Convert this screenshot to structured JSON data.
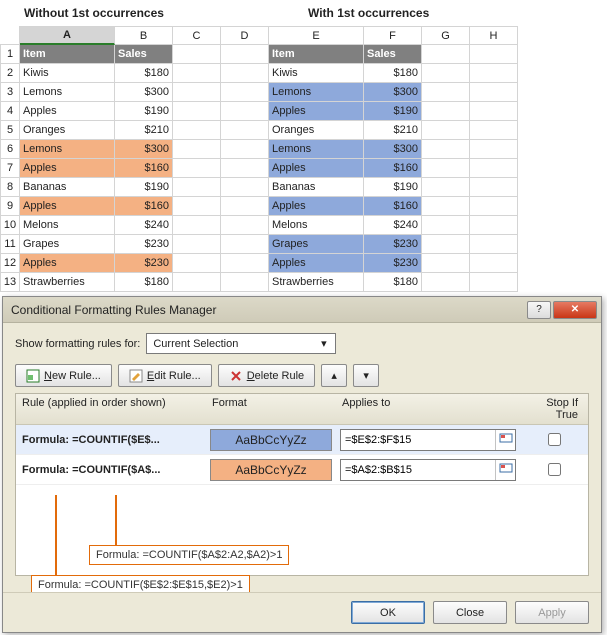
{
  "titles": {
    "left": "Without 1st occurrences",
    "right": "With 1st occurrences"
  },
  "columns": [
    "A",
    "B",
    "C",
    "D",
    "E",
    "F",
    "G",
    "H"
  ],
  "rows": [
    1,
    2,
    3,
    4,
    5,
    6,
    7,
    8,
    9,
    10,
    11,
    12,
    13
  ],
  "header_left": {
    "item": "Item",
    "sales": "Sales"
  },
  "header_right": {
    "item": "Item",
    "sales": "Sales"
  },
  "data_left": [
    {
      "item": "Kiwis",
      "sales": "$180",
      "hl": false
    },
    {
      "item": "Lemons",
      "sales": "$300",
      "hl": false
    },
    {
      "item": "Apples",
      "sales": "$190",
      "hl": false
    },
    {
      "item": "Oranges",
      "sales": "$210",
      "hl": false
    },
    {
      "item": "Lemons",
      "sales": "$300",
      "hl": true
    },
    {
      "item": "Apples",
      "sales": "$160",
      "hl": true
    },
    {
      "item": "Bananas",
      "sales": "$190",
      "hl": false
    },
    {
      "item": "Apples",
      "sales": "$160",
      "hl": true
    },
    {
      "item": "Melons",
      "sales": "$240",
      "hl": false
    },
    {
      "item": "Grapes",
      "sales": "$230",
      "hl": false
    },
    {
      "item": "Apples",
      "sales": "$230",
      "hl": true
    },
    {
      "item": "Strawberries",
      "sales": "$180",
      "hl": false
    }
  ],
  "data_right": [
    {
      "item": "Kiwis",
      "sales": "$180",
      "hl": false
    },
    {
      "item": "Lemons",
      "sales": "$300",
      "hl": true
    },
    {
      "item": "Apples",
      "sales": "$190",
      "hl": true
    },
    {
      "item": "Oranges",
      "sales": "$210",
      "hl": false
    },
    {
      "item": "Lemons",
      "sales": "$300",
      "hl": true
    },
    {
      "item": "Apples",
      "sales": "$160",
      "hl": true
    },
    {
      "item": "Bananas",
      "sales": "$190",
      "hl": false
    },
    {
      "item": "Apples",
      "sales": "$160",
      "hl": true
    },
    {
      "item": "Melons",
      "sales": "$240",
      "hl": false
    },
    {
      "item": "Grapes",
      "sales": "$230",
      "hl": true
    },
    {
      "item": "Apples",
      "sales": "$230",
      "hl": true
    },
    {
      "item": "Strawberries",
      "sales": "$180",
      "hl": false
    }
  ],
  "dialog": {
    "title": "Conditional Formatting Rules Manager",
    "show_label": "Show formatting rules for:",
    "show_value": "Current Selection",
    "buttons": {
      "new": "New Rule...",
      "edit": "Edit Rule...",
      "delete": "Delete Rule"
    },
    "cols": {
      "rule": "Rule (applied in order shown)",
      "format": "Format",
      "applies": "Applies to",
      "stop": "Stop If True"
    },
    "rules": [
      {
        "name": "Formula: =COUNTIF($E$...",
        "sample": "AaBbCcYyZz",
        "applies": "=$E$2:$F$15",
        "class": "blue"
      },
      {
        "name": "Formula: =COUNTIF($A$...",
        "sample": "AaBbCcYyZz",
        "applies": "=$A$2:$B$15",
        "class": "orange"
      }
    ],
    "footer": {
      "ok": "OK",
      "close": "Close",
      "apply": "Apply"
    }
  },
  "callouts": {
    "inner": "Formula: =COUNTIF($A$2:A2,$A2)>1",
    "outer": "Formula: =COUNTIF($E$2:$E$15,$E2)>1"
  }
}
